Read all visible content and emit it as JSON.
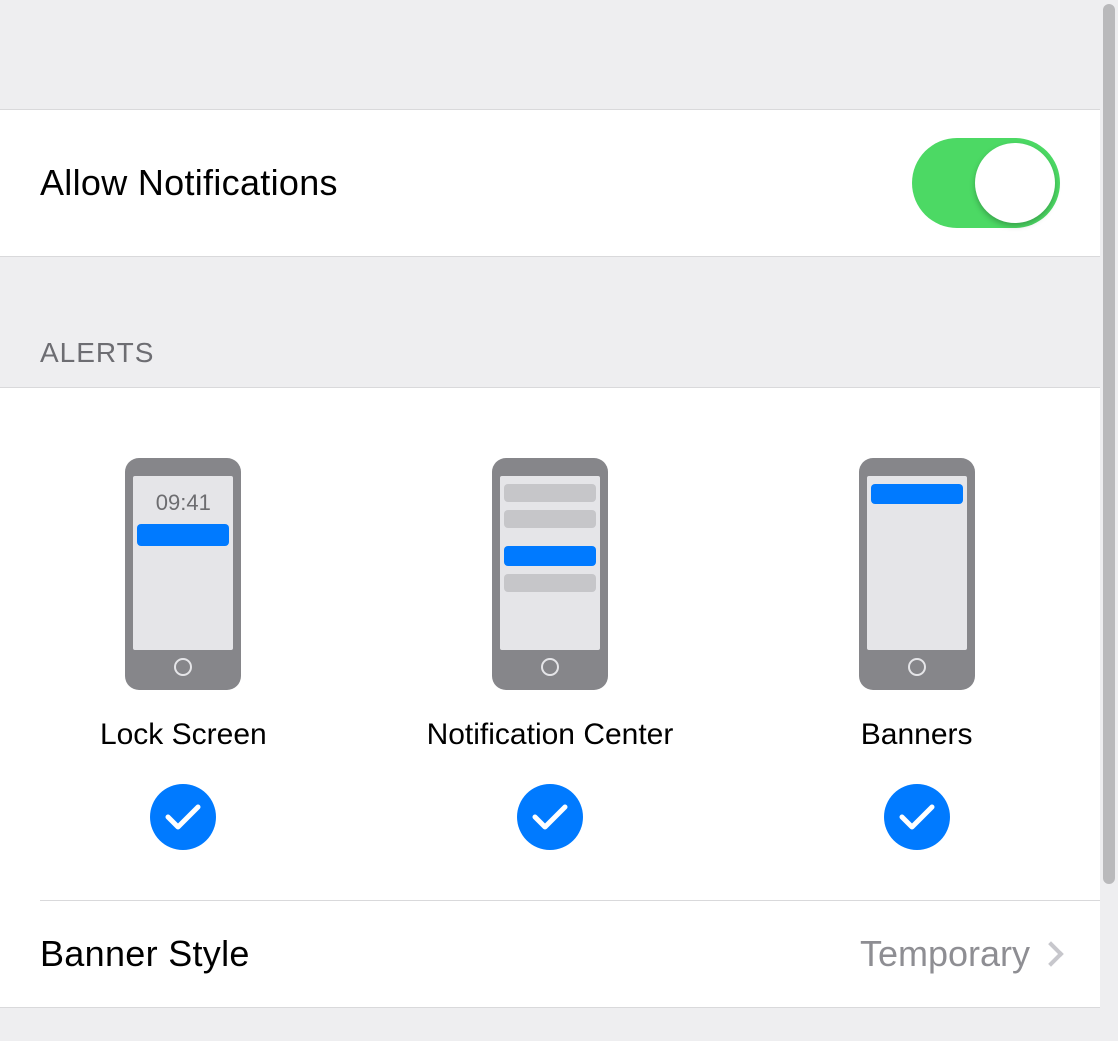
{
  "allowNotifications": {
    "label": "Allow Notifications",
    "enabled": true
  },
  "alertsSection": {
    "header": "ALERTS",
    "options": [
      {
        "label": "Lock Screen",
        "checked": true,
        "time": "09:41"
      },
      {
        "label": "Notification Center",
        "checked": true
      },
      {
        "label": "Banners",
        "checked": true
      }
    ],
    "bannerStyle": {
      "label": "Banner Style",
      "value": "Temporary"
    }
  }
}
